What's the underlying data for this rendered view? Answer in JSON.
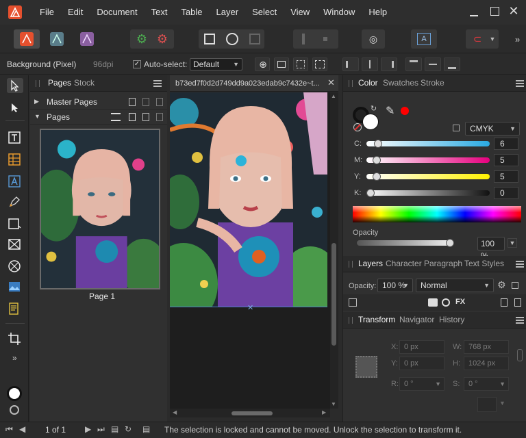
{
  "menubar": {
    "items": [
      "File",
      "Edit",
      "Document",
      "Text",
      "Table",
      "Layer",
      "Select",
      "View",
      "Window",
      "Help"
    ]
  },
  "context": {
    "layer_name": "Background (Pixel)",
    "dpi": "96dpi",
    "autoselect_label": "Auto-select:",
    "autoselect_value": "Default"
  },
  "pages_panel": {
    "tabs": [
      "Pages",
      "Stock"
    ],
    "master_pages_label": "Master Pages",
    "pages_label": "Pages",
    "page_label": "Page 1"
  },
  "document": {
    "tab_title": "b73ed7f0d2d749dd9a023edab9c7432e~t..."
  },
  "color_panel": {
    "tabs": [
      "Color",
      "Swatches",
      "Stroke"
    ],
    "model": "CMYK",
    "channels": [
      {
        "label": "C:",
        "value": "6",
        "level": 0.06,
        "gradient": "linear-gradient(90deg,#ffffff,#29a9e1)"
      },
      {
        "label": "M:",
        "value": "5",
        "level": 0.05,
        "gradient": "linear-gradient(90deg,#ffffff,#e6007e)"
      },
      {
        "label": "Y:",
        "value": "5",
        "level": 0.05,
        "gradient": "linear-gradient(90deg,#ffffff,#fff200)"
      },
      {
        "label": "K:",
        "value": "0",
        "level": 0.0,
        "gradient": "linear-gradient(90deg,#ffffff,#111111)"
      }
    ],
    "opacity_label": "Opacity",
    "opacity_value": "100 %",
    "opacity_level": 1.0
  },
  "layers_panel": {
    "tabs": [
      "Layers",
      "Character",
      "Paragraph",
      "Text Styles"
    ],
    "opacity_label": "Opacity:",
    "opacity_value": "100 %",
    "blend_mode": "Normal"
  },
  "transform_panel": {
    "tabs": [
      "Transform",
      "Navigator",
      "History"
    ],
    "x_label": "X:",
    "x_value": "0 px",
    "y_label": "Y:",
    "y_value": "0 px",
    "w_label": "W:",
    "w_value": "768 px",
    "h_label": "H:",
    "h_value": "1024 px",
    "r_label": "R:",
    "r_value": "0 °",
    "s_label": "S:",
    "s_value": "0 °"
  },
  "status": {
    "pages": "1 of 1",
    "message": "The selection is locked and cannot be moved. Unlock the selection to transform it."
  },
  "colors": {
    "accent": "#4a7fc9",
    "brand": "#e5502e",
    "secondary_swatch": "#ff0000"
  }
}
